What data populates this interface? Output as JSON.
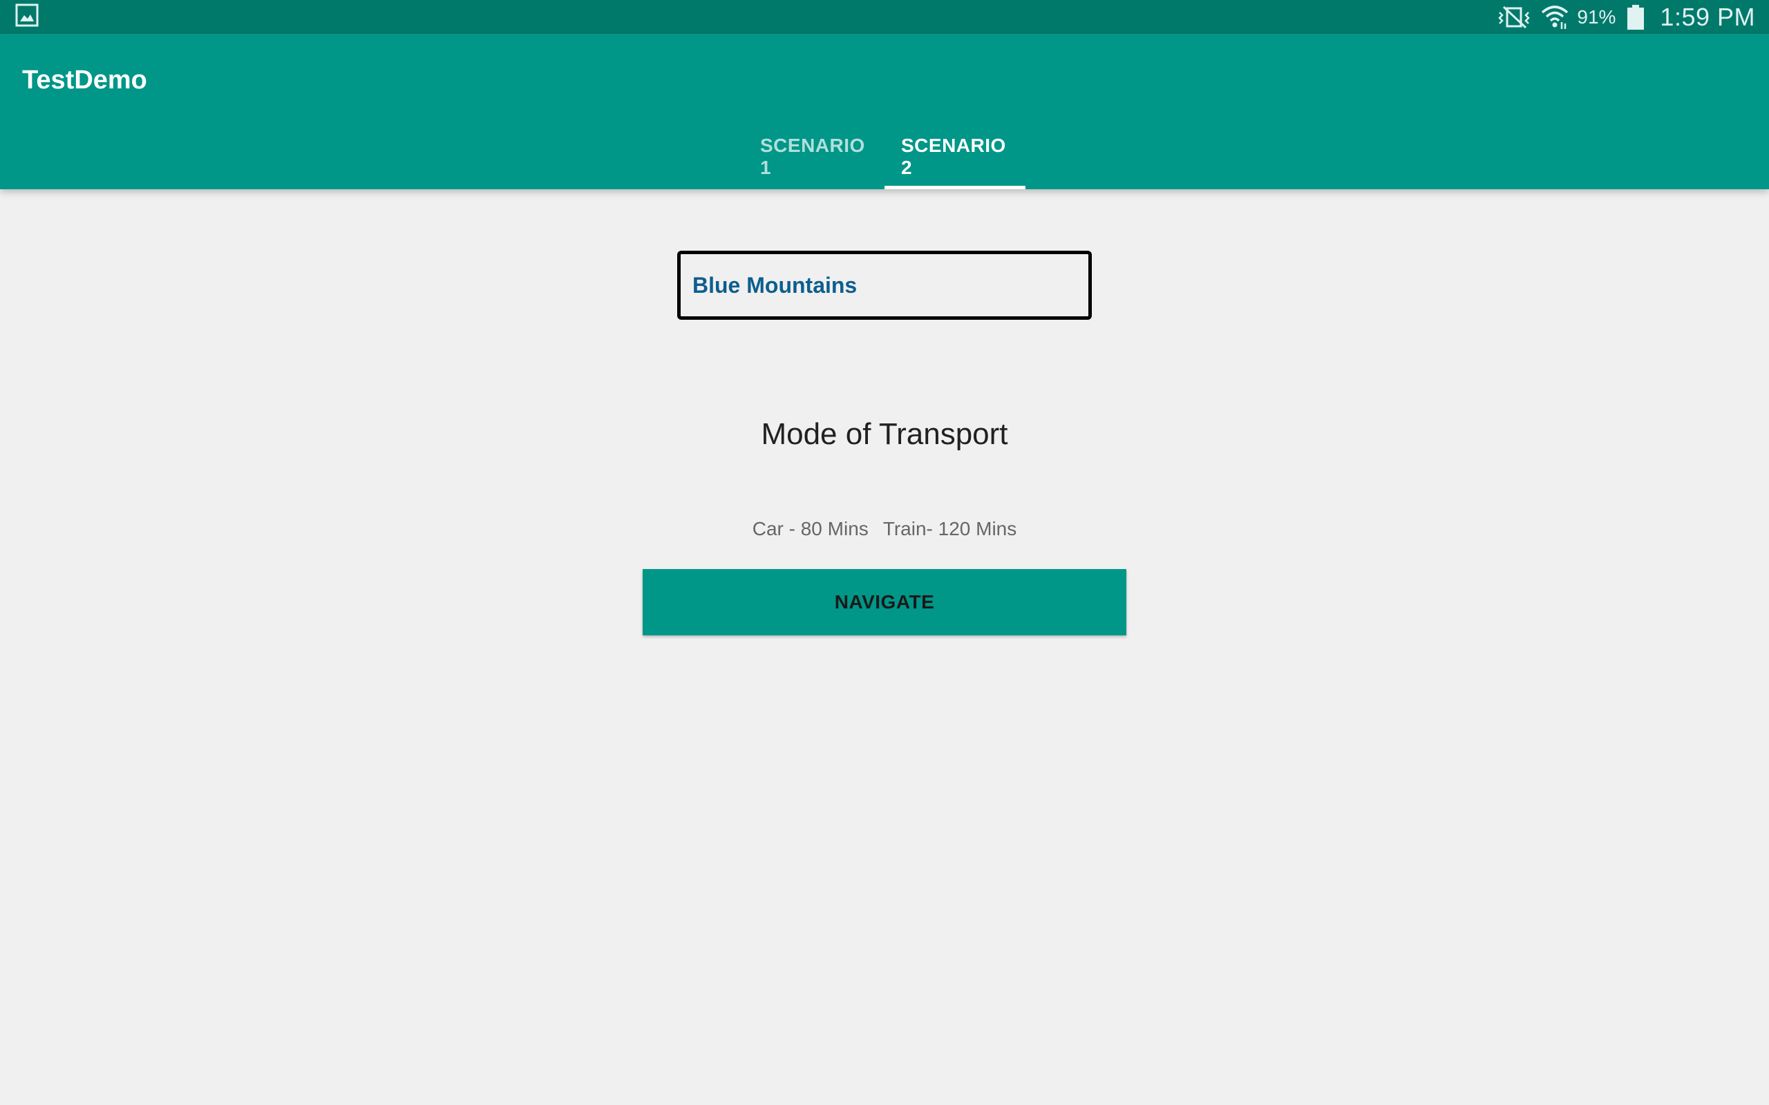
{
  "status_bar": {
    "notification_icon": "gallery-icon",
    "icons": [
      "vibrate-mute-icon",
      "wifi-icon"
    ],
    "battery_percent": "91%",
    "battery_icon": "battery-icon",
    "time": "1:59 PM"
  },
  "app_bar": {
    "title": "TestDemo",
    "tabs": [
      {
        "label": "SCENARIO 1",
        "active": false
      },
      {
        "label": "SCENARIO 2",
        "active": true
      }
    ]
  },
  "main": {
    "destination": "Blue Mountains",
    "section_title": "Mode of Transport",
    "transport_options": [
      "Car - 80 Mins",
      "Train- 120 Mins"
    ],
    "navigate_label": "NAVIGATE"
  },
  "colors": {
    "status_bar": "#00796b",
    "primary": "#009688",
    "background": "#f0f0f0",
    "destination_text": "#0d5e8f"
  }
}
